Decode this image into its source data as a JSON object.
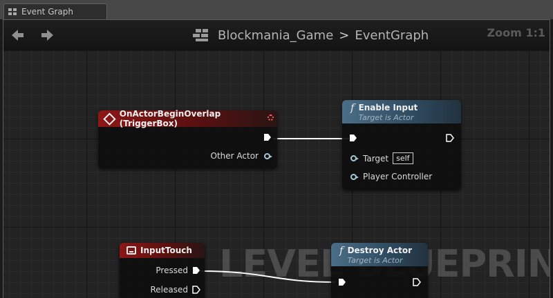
{
  "tab": {
    "title": "Event Graph"
  },
  "header": {
    "back_icon": "back-arrow-icon",
    "forward_icon": "forward-arrow-icon",
    "breadcrumb_root": "Blockmania_Game",
    "breadcrumb_separator": ">",
    "breadcrumb_current": "EventGraph",
    "zoom": "Zoom 1:1"
  },
  "watermark": "LEVEL BLUEPRINT",
  "nodes": {
    "overlap": {
      "title": "OnActorBeginOverlap (TriggerBox)",
      "pin_other_actor": "Other Actor"
    },
    "enable_input": {
      "title": "Enable Input",
      "subtitle": "Target is Actor",
      "pin_target": "Target",
      "target_default": "self",
      "pin_player_controller": "Player Controller"
    },
    "input_touch": {
      "title": "InputTouch",
      "pin_pressed": "Pressed",
      "pin_released": "Released"
    },
    "destroy_actor": {
      "title": "Destroy Actor",
      "subtitle": "Target is Actor"
    }
  },
  "colors": {
    "event_header": "#8d1717",
    "function_header": "#4b6e88",
    "grid_background": "#232323",
    "wire": "#ffffff"
  }
}
